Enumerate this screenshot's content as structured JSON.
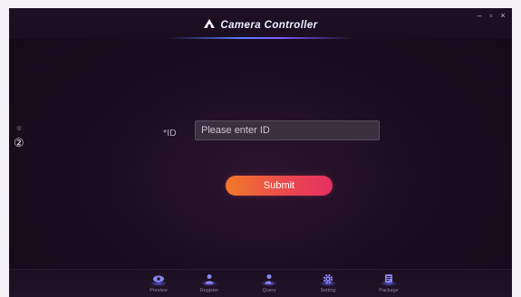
{
  "window": {
    "title": "Camera Controller",
    "title_icon": "camera-logo-icon",
    "controls": {
      "minimize": "–",
      "maximize": "▫",
      "close": "×"
    }
  },
  "side_indicator": {
    "small": "①",
    "main": "②"
  },
  "form": {
    "id_label": "*ID",
    "id_placeholder": "Please enter ID",
    "id_value": "",
    "submit_label": "Submit"
  },
  "nav": {
    "items": [
      {
        "label": "Preview",
        "icon": "eye-icon"
      },
      {
        "label": "Register",
        "icon": "user-icon"
      },
      {
        "label": "Query",
        "icon": "user-search-icon"
      },
      {
        "label": "Setting",
        "icon": "gear-icon"
      },
      {
        "label": "Package",
        "icon": "package-icon"
      }
    ]
  },
  "colors": {
    "background": "#1b0d21",
    "accent_start": "#f17a2b",
    "accent_end": "#e52f63",
    "nav_icon": "#7d7bf0"
  }
}
